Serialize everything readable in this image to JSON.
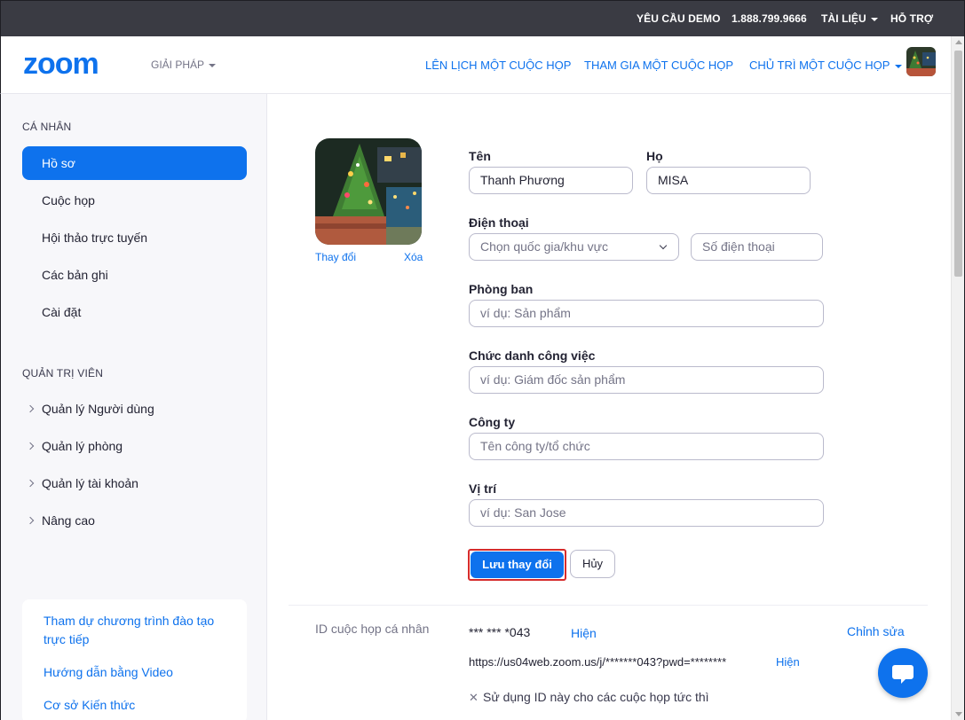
{
  "topbar": {
    "demo": "YÊU CẦU DEMO",
    "phone": "1.888.799.9666",
    "docs": "TÀI LIỆU",
    "support": "HỖ TRỢ"
  },
  "header": {
    "logo": "zoom",
    "solutions": "GIẢI PHÁP",
    "schedule": "LÊN LỊCH MỘT CUỘC HỌP",
    "join": "THAM GIA MỘT CUỘC HỌP",
    "host": "CHỦ TRÌ MỘT CUỘC HỌP"
  },
  "sidebar": {
    "personal_title": "CÁ NHÂN",
    "personal_items": [
      {
        "label": "Hồ sơ",
        "active": true
      },
      {
        "label": "Cuộc họp",
        "active": false
      },
      {
        "label": "Hội thảo trực tuyến",
        "active": false
      },
      {
        "label": "Các bản ghi",
        "active": false
      },
      {
        "label": "Cài đặt",
        "active": false
      }
    ],
    "admin_title": "QUẢN TRỊ VIÊN",
    "admin_items": [
      {
        "label": "Quản lý Người dùng"
      },
      {
        "label": "Quản lý phòng"
      },
      {
        "label": "Quản lý tài khoản"
      },
      {
        "label": "Nâng cao"
      }
    ],
    "help_links": [
      {
        "label": "Tham dự chương trình đào tạo trực tiếp"
      },
      {
        "label": "Hướng dẫn bằng Video"
      },
      {
        "label": "Cơ sở Kiến thức"
      }
    ]
  },
  "profile": {
    "change_photo": "Thay đổi",
    "delete_photo": "Xóa",
    "first_name_label": "Tên",
    "first_name_value": "Thanh Phương",
    "last_name_label": "Họ",
    "last_name_value": "MISA",
    "phone_label": "Điện thoại",
    "country_placeholder": "Chọn quốc gia/khu vực",
    "phone_placeholder": "Số điện thoại",
    "department_label": "Phòng ban",
    "department_placeholder": "ví dụ: Sản phẩm",
    "job_title_label": "Chức danh công việc",
    "job_title_placeholder": "ví dụ: Giám đốc sản phẩm",
    "company_label": "Công ty",
    "company_placeholder": "Tên công ty/tổ chức",
    "location_label": "Vị trí",
    "location_placeholder": "ví dụ: San Jose",
    "save_label": "Lưu thay đổi",
    "cancel_label": "Hủy"
  },
  "meeting_id": {
    "label": "ID cuộc họp cá nhân",
    "value": "*** *** *043",
    "show": "Hiện",
    "edit": "Chỉnh sửa",
    "url": "https://us04web.zoom.us/j/*******043?pwd=********",
    "show_url": "Hiện",
    "instant_option": "Sử dụng ID này cho các cuộc họp tức thì"
  },
  "colors": {
    "accent": "#0e72ed",
    "topbar": "#3a3b43",
    "sidebar": "#f7f7fa",
    "highlight_border": "#d62c2c"
  }
}
